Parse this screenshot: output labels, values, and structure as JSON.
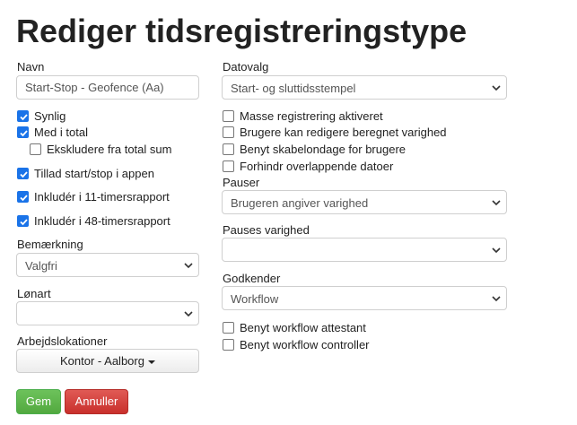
{
  "page_title": "Rediger tidsregistreringstype",
  "left": {
    "name_label": "Navn",
    "name_value": "Start-Stop - Geofence (Aa)",
    "checkboxes": [
      {
        "label": "Synlig",
        "checked": true
      },
      {
        "label": "Med i total",
        "checked": true
      },
      {
        "label": "Ekskludere fra total sum",
        "checked": false
      },
      {
        "label": "Tillad start/stop i appen",
        "checked": true
      },
      {
        "label": "Inkludér i 11-timersrapport",
        "checked": true
      },
      {
        "label": "Inkludér i 48-timersrapport",
        "checked": true
      }
    ],
    "remark_label": "Bemærkning",
    "remark_value": "Valgfri",
    "wage_label": "Lønart",
    "wage_value": "",
    "locations_label": "Arbejdslokationer",
    "locations_value": "Kontor - Aalborg"
  },
  "right": {
    "date_label": "Datovalg",
    "date_value": "Start- og sluttidsstempel",
    "checkboxes": [
      {
        "label": "Masse registrering aktiveret",
        "checked": false
      },
      {
        "label": "Brugere kan redigere beregnet varighed",
        "checked": false
      },
      {
        "label": "Benyt skabelondage for brugere",
        "checked": false
      },
      {
        "label": "Forhindr overlappende datoer",
        "checked": false
      }
    ],
    "breaks_label": "Pauser",
    "breaks_value": "Brugeren angiver varighed",
    "break_duration_label": "Pauses varighed",
    "break_duration_value": "",
    "approver_label": "Godkender",
    "approver_value": "Workflow",
    "workflow_checkboxes": [
      {
        "label": "Benyt workflow attestant",
        "checked": false
      },
      {
        "label": "Benyt workflow controller",
        "checked": false
      }
    ]
  },
  "buttons": {
    "save": "Gem",
    "cancel": "Annuller"
  },
  "colors": {
    "checkbox_checked": "#1a73e8",
    "save_button": "#5cb85c",
    "cancel_button": "#d9534f"
  }
}
